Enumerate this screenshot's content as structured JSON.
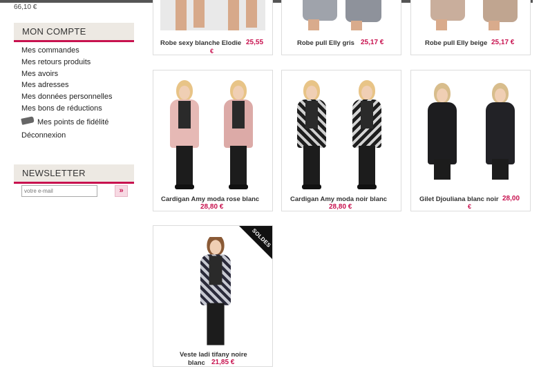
{
  "header": {
    "cart_total": "66,10 €"
  },
  "account": {
    "title": "MON COMPTE",
    "links": [
      "Mes commandes",
      "Mes retours produits",
      "Mes avoirs",
      "Mes adresses",
      "Mes données personnelles",
      "Mes bons de réductions"
    ],
    "loyalty": "Mes points de fidélité",
    "logout": "Déconnexion"
  },
  "newsletter": {
    "title": "NEWSLETTER",
    "placeholder": "votre e-mail",
    "submit": "»"
  },
  "products_top": [
    {
      "name": "Robe sexy blanche Elodie",
      "price": "25,55",
      "currency": "€"
    },
    {
      "name": "Robe pull Elly gris",
      "price": "25,17 €"
    },
    {
      "name": "Robe pull Elly beige",
      "price": "25,17 €"
    }
  ],
  "products": [
    {
      "name": "Cardigan Amy moda rose blanc",
      "price": "28,80 €"
    },
    {
      "name": "Cardigan Amy moda noir blanc",
      "price": "28,80 €"
    },
    {
      "name": "Gilet Djouliana blanc noir",
      "price": "28,00",
      "currency": "€"
    },
    {
      "name": "Veste ladi tifany noire",
      "name2": "blanc",
      "price": "21,85 €",
      "badge": "SOLDES"
    }
  ],
  "colors": {
    "accent": "#c8124f",
    "block_bg": "#ede9e3"
  }
}
